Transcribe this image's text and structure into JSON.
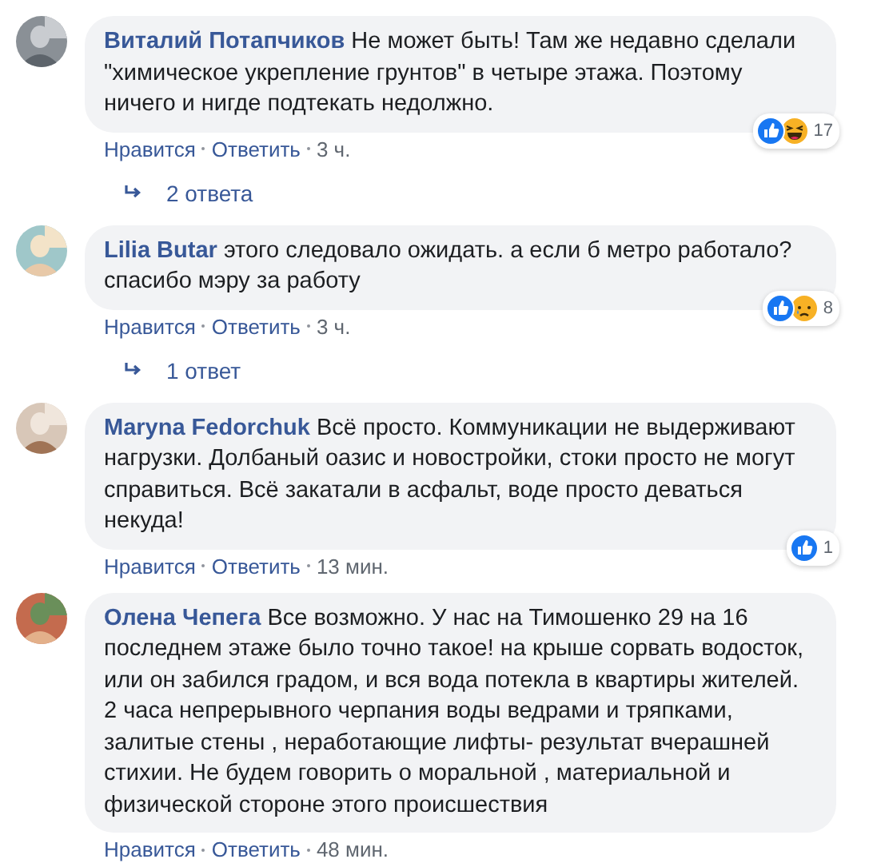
{
  "comments": [
    {
      "author": "Виталий Потапчиков",
      "text": "Не может быть! Там же недавно сделали \"химическое укрепление грунтов\" в четыре этажа. Поэтому ничего и нигде подтекать недолжно.",
      "reactions": [
        {
          "kind": "like"
        },
        {
          "kind": "haha"
        }
      ],
      "reaction_count": "17",
      "actions": [
        "Нравится",
        "Ответить"
      ],
      "time": "3 ч.",
      "replies": "2 ответа"
    },
    {
      "author": "Lilia Butar",
      "text": "этого следовало ожидать. а если б метро работало? спасибо мэру за работу",
      "reactions": [
        {
          "kind": "like"
        },
        {
          "kind": "sad"
        }
      ],
      "reaction_count": "8",
      "actions": [
        "Нравится",
        "Ответить"
      ],
      "time": "3 ч.",
      "replies": "1 ответ"
    },
    {
      "author": "Maryna Fedorchuk",
      "text": "Всё просто. Коммуникации не выдерживают нагрузки. Долбаный оазис и новостройки, стоки просто не могут справиться. Всё закатали в асфальт, воде просто деваться некуда!",
      "reactions": [
        {
          "kind": "like"
        }
      ],
      "reaction_count": "1",
      "actions": [
        "Нравится",
        "Ответить"
      ],
      "time": "13 мин."
    },
    {
      "author": "Олена Чепега",
      "text": "Все возможно. У нас на Тимошенко 29 на 16 последнем этаже было точно такое! на крыше сорвать водосток, или он забился градом, и вся вода потекла в квартиры жителей. 2 часа непрерывного черпания воды ведрами и тряпками, залитые стены , неработающие лифты- результат вчерашней стихии. Не будем говорить о моральной , материальной и физической стороне этого происшествия",
      "actions": [
        "Нравится",
        "Ответить"
      ],
      "time": "48 мин."
    }
  ]
}
